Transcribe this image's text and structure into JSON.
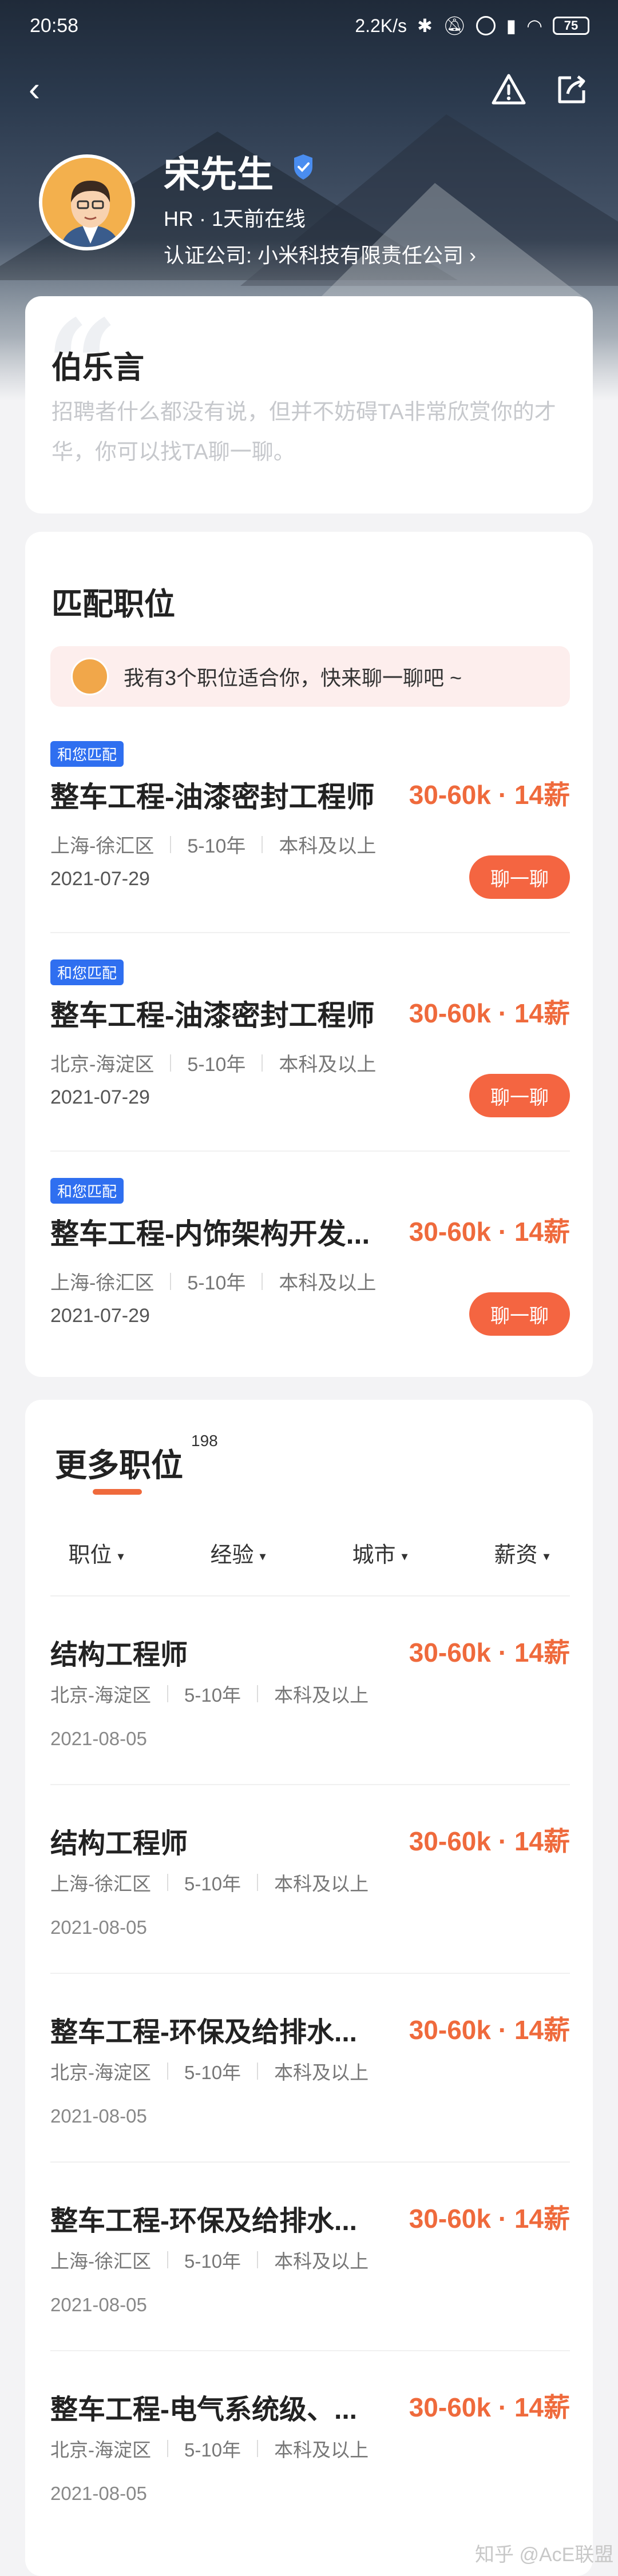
{
  "status_bar": {
    "time": "20:58",
    "net_speed": "2.2K/s",
    "battery": "75"
  },
  "profile": {
    "name": "宋先生",
    "role_line": "HR  ·  1天前在线",
    "company_line": "认证公司: 小米科技有限责任公司 ›"
  },
  "intro": {
    "title": "伯乐言",
    "text": "招聘者什么都没有说，但并不妨碍TA非常欣赏你的才华，你可以找TA聊一聊。"
  },
  "match": {
    "title": "匹配职位",
    "bubble_text": "我有3个职位适合你，快来聊一聊吧 ~",
    "jobs": [
      {
        "tag": "和您匹配",
        "title": "整车工程-油漆密封工程师",
        "salary": "30-60k · 14薪",
        "location": "上海-徐汇区",
        "exp": "5-10年",
        "edu": "本科及以上",
        "date": "2021-07-29",
        "btn": "聊一聊"
      },
      {
        "tag": "和您匹配",
        "title": "整车工程-油漆密封工程师",
        "salary": "30-60k · 14薪",
        "location": "北京-海淀区",
        "exp": "5-10年",
        "edu": "本科及以上",
        "date": "2021-07-29",
        "btn": "聊一聊"
      },
      {
        "tag": "和您匹配",
        "title": "整车工程-内饰架构开发...",
        "salary": "30-60k · 14薪",
        "location": "上海-徐汇区",
        "exp": "5-10年",
        "edu": "本科及以上",
        "date": "2021-07-29",
        "btn": "聊一聊"
      }
    ]
  },
  "more": {
    "title": "更多职位",
    "count": "198",
    "filters": [
      "职位",
      "经验",
      "城市",
      "薪资"
    ],
    "jobs": [
      {
        "title": "结构工程师",
        "salary": "30-60k · 14薪",
        "location": "北京-海淀区",
        "exp": "5-10年",
        "edu": "本科及以上",
        "date": "2021-08-05"
      },
      {
        "title": "结构工程师",
        "salary": "30-60k · 14薪",
        "location": "上海-徐汇区",
        "exp": "5-10年",
        "edu": "本科及以上",
        "date": "2021-08-05"
      },
      {
        "title": "整车工程-环保及给排水...",
        "salary": "30-60k · 14薪",
        "location": "北京-海淀区",
        "exp": "5-10年",
        "edu": "本科及以上",
        "date": "2021-08-05"
      },
      {
        "title": "整车工程-环保及给排水...",
        "salary": "30-60k · 14薪",
        "location": "上海-徐汇区",
        "exp": "5-10年",
        "edu": "本科及以上",
        "date": "2021-08-05"
      },
      {
        "title": "整车工程-电气系统级、...",
        "salary": "30-60k · 14薪",
        "location": "北京-海淀区",
        "exp": "5-10年",
        "edu": "本科及以上",
        "date": "2021-08-05"
      }
    ]
  },
  "watermark": "知乎 @AcE联盟"
}
